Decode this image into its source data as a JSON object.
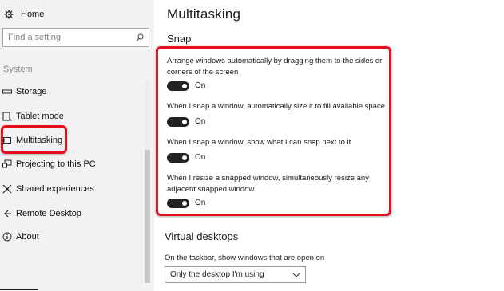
{
  "sidebar": {
    "home_label": "Home",
    "search_placeholder": "Find a setting",
    "section_label": "System",
    "items": [
      {
        "label": "Storage",
        "icon": "storage-icon"
      },
      {
        "label": "Tablet mode",
        "icon": "tablet-mode-icon"
      },
      {
        "label": "Multitasking",
        "icon": "multitasking-icon",
        "selected": true
      },
      {
        "label": "Projecting to this PC",
        "icon": "projecting-icon"
      },
      {
        "label": "Shared experiences",
        "icon": "shared-experiences-icon"
      },
      {
        "label": "Remote Desktop",
        "icon": "remote-desktop-icon"
      },
      {
        "label": "About",
        "icon": "about-icon"
      }
    ]
  },
  "main": {
    "title": "Multitasking",
    "snap": {
      "heading": "Snap",
      "options": [
        {
          "label": "Arrange windows automatically by dragging them to the sides or corners of the screen",
          "state": "On"
        },
        {
          "label": "When I snap a window, automatically size it to fill available space",
          "state": "On"
        },
        {
          "label": "When I snap a window, show what I can snap next to it",
          "state": "On"
        },
        {
          "label": "When I resize a snapped window, simultaneously resize any adjacent snapped window",
          "state": "On"
        }
      ]
    },
    "virtual_desktops": {
      "heading": "Virtual desktops",
      "taskbar_label": "On the taskbar, show windows that are open on",
      "taskbar_value": "Only the desktop I'm using"
    }
  },
  "colors": {
    "highlight_red": "#e4101b",
    "toggle_on": "#222222",
    "sidebar_bg": "#f2f2f2"
  }
}
